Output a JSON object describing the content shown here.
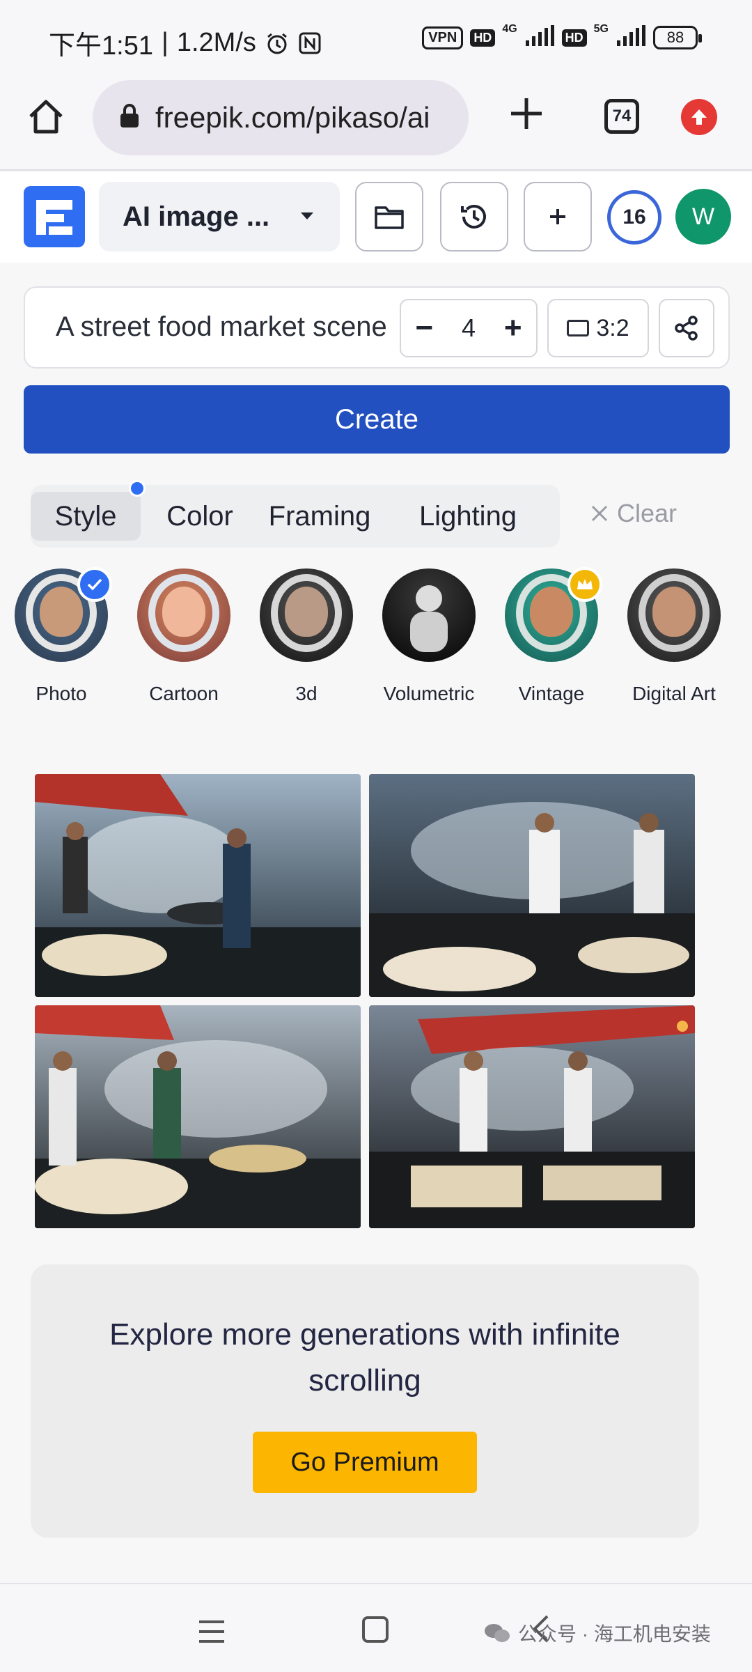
{
  "status_bar": {
    "time": "下午1:51",
    "speed": "1.2M/s",
    "vpn": "VPN",
    "hd1": "HD",
    "net1": "4G",
    "hd2": "HD",
    "net2": "5G",
    "battery": "88"
  },
  "browser": {
    "url": "freepik.com/pikaso/ai",
    "tab_count": "74"
  },
  "toolbar": {
    "mode_label": "AI image ...",
    "credits": "16",
    "avatar_initial": "W"
  },
  "prompt": {
    "text": "A street food market scene",
    "quantity": "4",
    "minus": "−",
    "plus": "+",
    "aspect_ratio": "3:2"
  },
  "create_label": "Create",
  "option_tabs": [
    {
      "label": "Style",
      "active": true
    },
    {
      "label": "Color"
    },
    {
      "label": "Framing"
    },
    {
      "label": "Lighting"
    }
  ],
  "clear_label": "Clear",
  "styles": [
    {
      "label": "Photo",
      "selected": true
    },
    {
      "label": "Cartoon"
    },
    {
      "label": "3d"
    },
    {
      "label": "Volumetric"
    },
    {
      "label": "Vintage",
      "premium": true
    },
    {
      "label": "Digital Art"
    }
  ],
  "premium": {
    "message": "Explore more generations with infinite scrolling",
    "button": "Go Premium"
  },
  "watermark": "公众号 · 海工机电安装",
  "colors": {
    "accent": "#2350c0",
    "brand": "#2f6df2",
    "premium": "#fcb500",
    "avatar": "#10966b"
  }
}
